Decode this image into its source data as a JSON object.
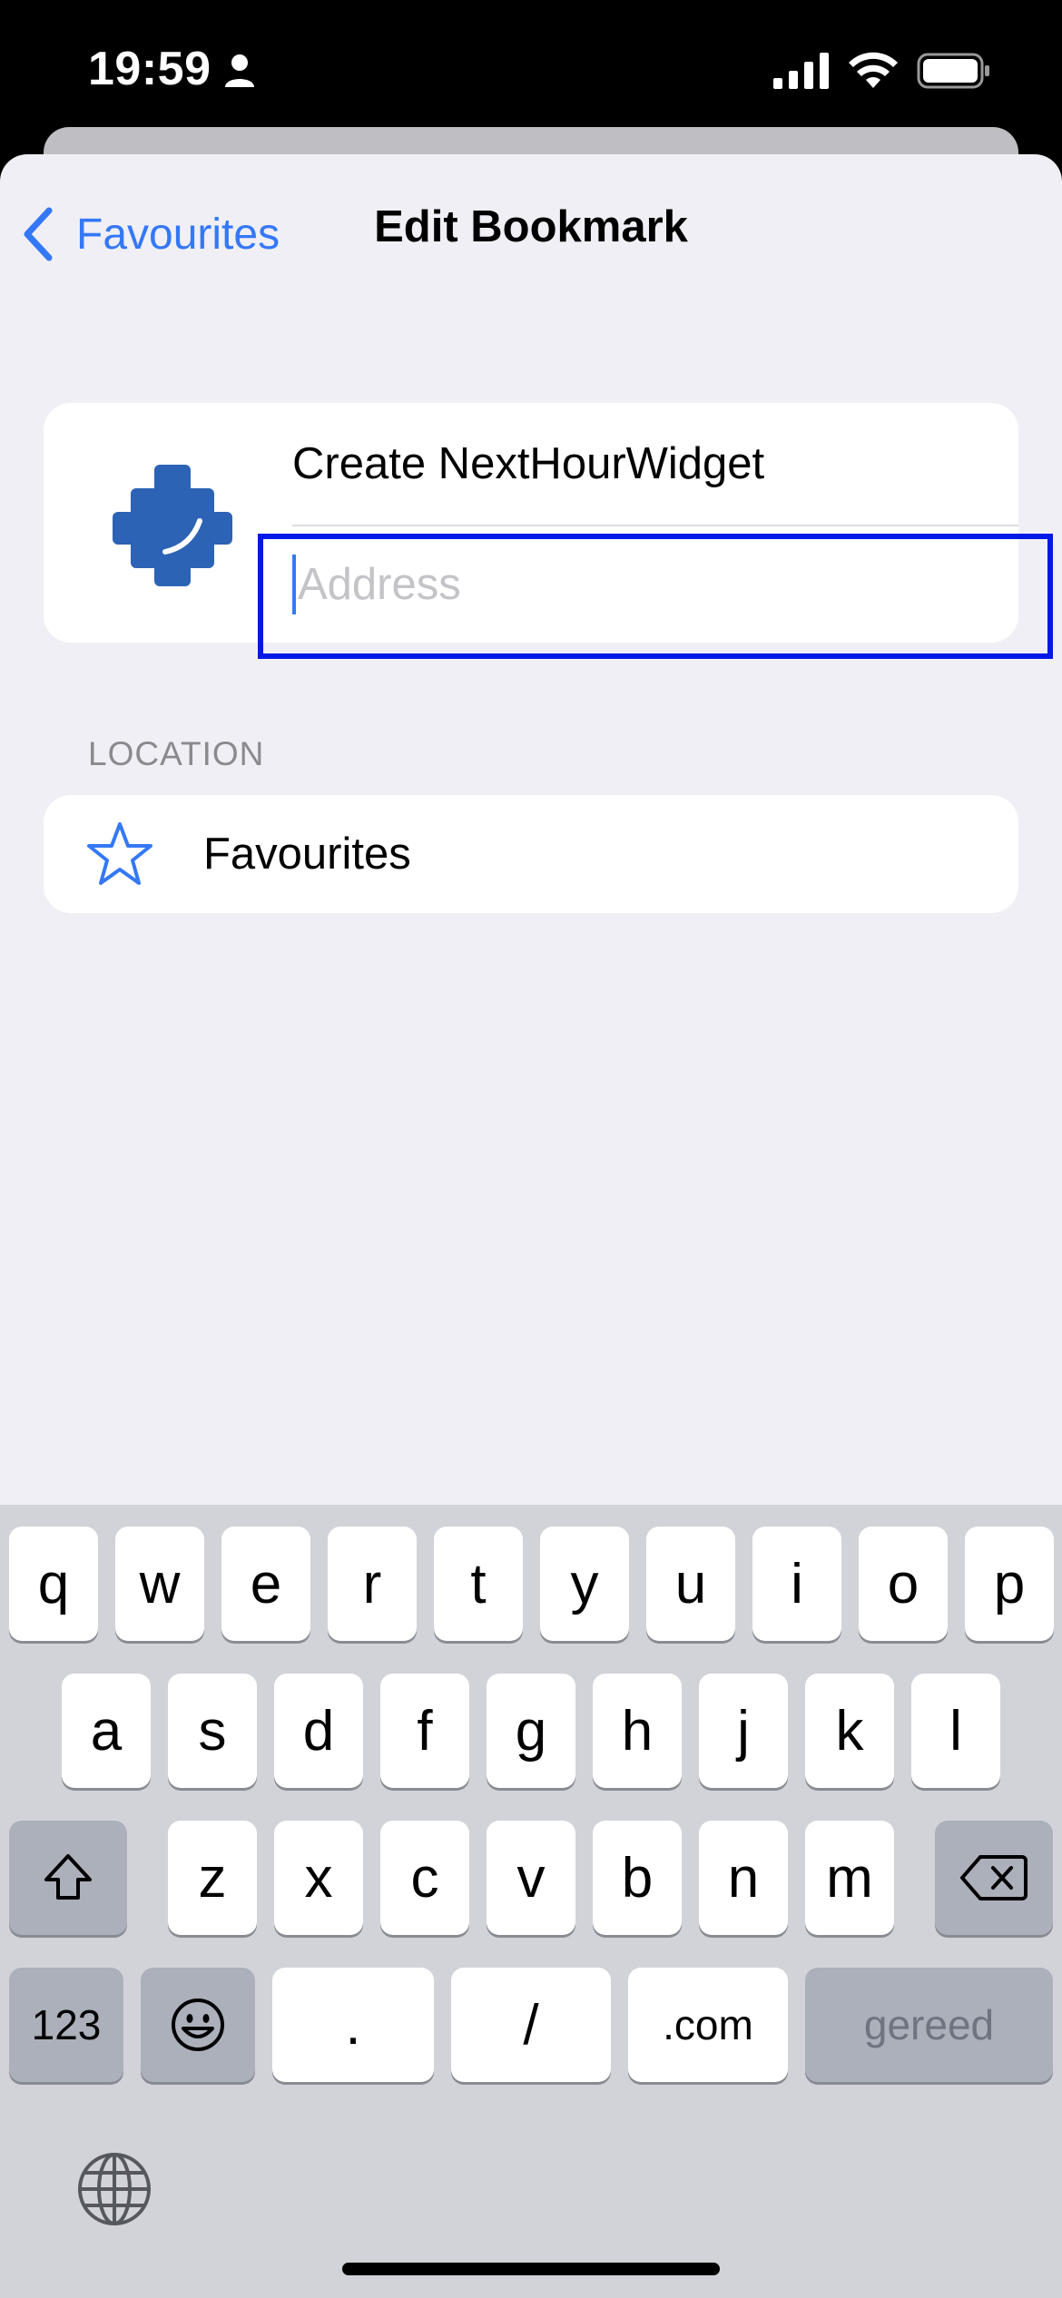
{
  "status_bar": {
    "time": "19:59"
  },
  "nav": {
    "back_label": "Favourites",
    "title": "Edit Bookmark"
  },
  "bookmark": {
    "title_value": "Create NextHourWidget",
    "address_value": "",
    "address_placeholder": "Address"
  },
  "location": {
    "section_header": "LOCATION",
    "folder_label": "Favourites"
  },
  "keyboard": {
    "row1": [
      "q",
      "w",
      "e",
      "r",
      "t",
      "y",
      "u",
      "i",
      "o",
      "p"
    ],
    "row2": [
      "a",
      "s",
      "d",
      "f",
      "g",
      "h",
      "j",
      "k",
      "l"
    ],
    "row3": [
      "z",
      "x",
      "c",
      "v",
      "b",
      "n",
      "m"
    ],
    "numbers_label": "123",
    "period_label": ".",
    "slash_label": "/",
    "dotcom_label": ".com",
    "done_label": "gereed"
  },
  "colors": {
    "accent": "#3478f6",
    "focus_outline": "#0019e6",
    "icon_blue": "#2c63b5"
  },
  "icons": {
    "back": "chevron-left-icon",
    "app": "puzzle-piece-icon",
    "location": "star-icon",
    "shift": "shift-icon",
    "delete": "backspace-icon",
    "emoji": "emoji-icon",
    "globe": "globe-icon"
  }
}
